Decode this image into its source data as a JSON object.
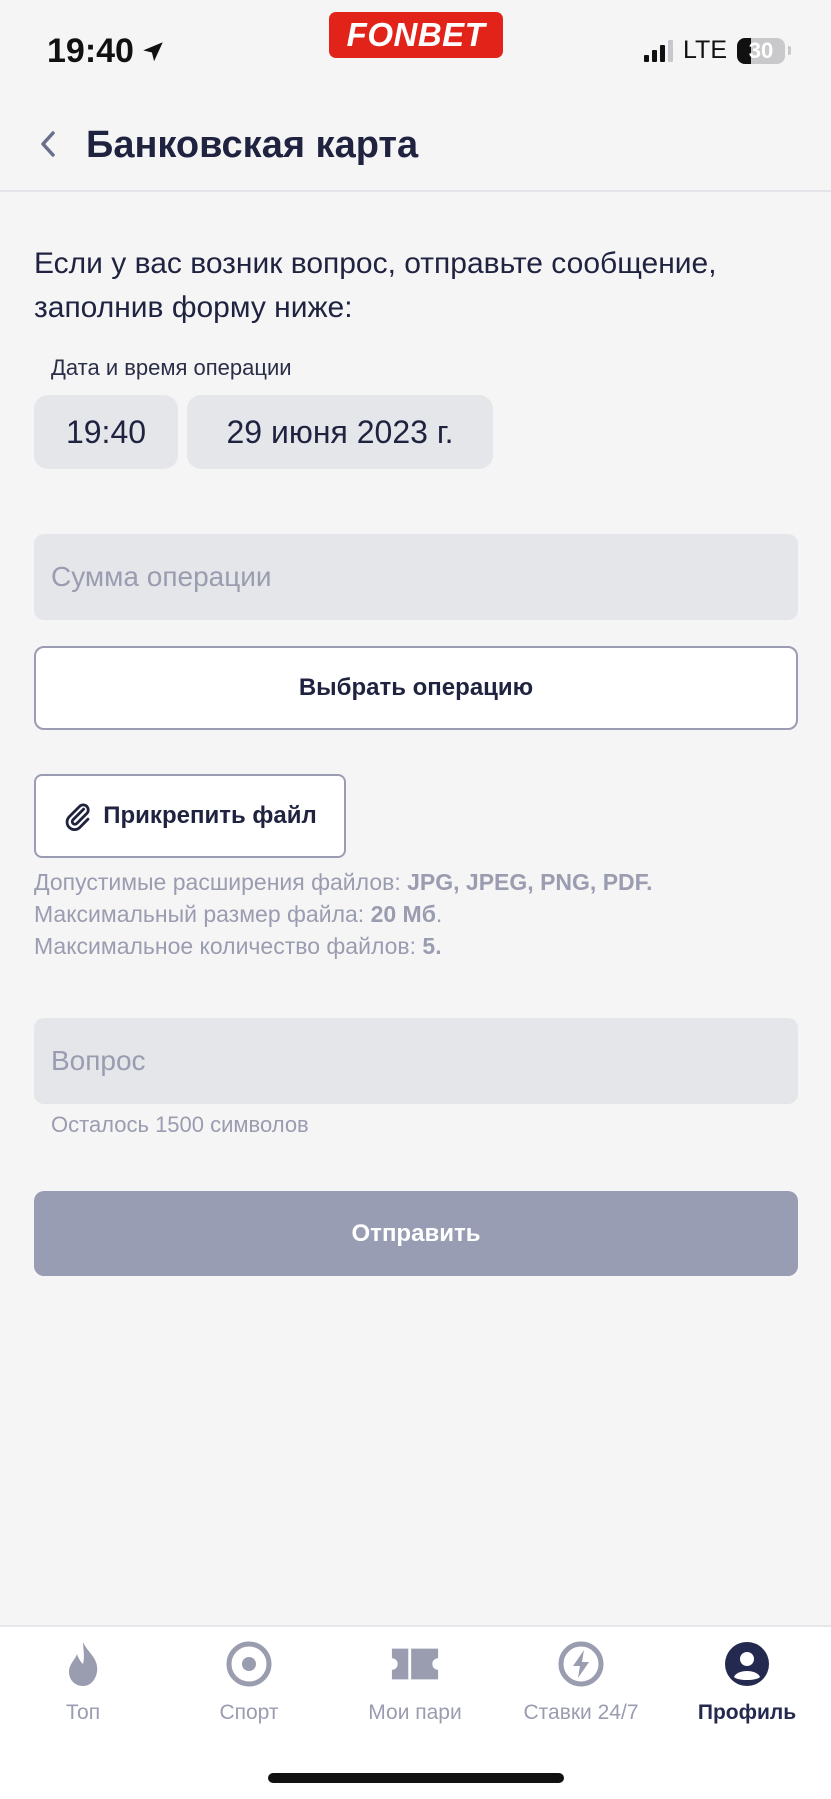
{
  "status_bar": {
    "time": "19:40",
    "brand": "FONBET",
    "network": "LTE",
    "battery": "30",
    "battery_level": 0.3
  },
  "header": {
    "title": "Банковская карта"
  },
  "form": {
    "intro": "Если у вас возник вопрос, отправьте сообщение, заполнив форму ниже:",
    "datetime_label": "Дата и время операции",
    "time_value": "19:40",
    "date_value": "29 июня 2023 г.",
    "amount_placeholder": "Сумма операции",
    "select_operation_label": "Выбрать операцию",
    "attach_label": "Прикрепить файл",
    "rules": {
      "ext_prefix": "Допустимые расширения файлов: ",
      "ext_value": "JPG, JPEG, PNG, PDF.",
      "size_prefix": "Максимальный размер файла: ",
      "size_value": "20 Мб",
      "size_suffix": ".",
      "count_prefix": "Максимальное количество файлов: ",
      "count_value": "5."
    },
    "question_placeholder": "Вопрос",
    "chars_left": "Осталось 1500 символов",
    "submit_label": "Отправить"
  },
  "colors": {
    "accent": "#23294f",
    "muted": "#9a9cb0",
    "submit_disabled": "#999db3",
    "brand_red": "#e2231a"
  },
  "bottom_nav": {
    "items": [
      {
        "label": "Топ",
        "icon": "flame-icon",
        "active": false
      },
      {
        "label": "Спорт",
        "icon": "target-icon",
        "active": false
      },
      {
        "label": "Мои пари",
        "icon": "ticket-icon",
        "active": false
      },
      {
        "label": "Ставки 24/7",
        "icon": "lightning-icon",
        "active": false
      },
      {
        "label": "Профиль",
        "icon": "profile-icon",
        "active": true
      }
    ]
  }
}
